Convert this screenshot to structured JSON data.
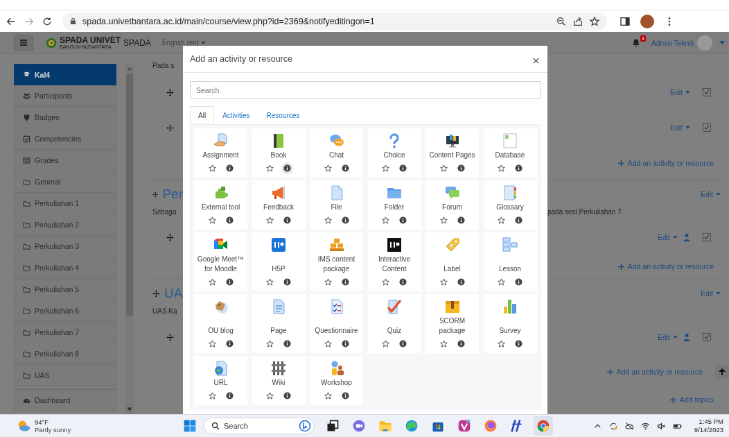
{
  "browser": {
    "url": "spada.univetbantara.ac.id/main/course/view.php?id=2369&notifyeditingon=1"
  },
  "navbar": {
    "brand": "SPADA UNIVET",
    "brand_tagline": "BANGUN NUSANTARA",
    "site_name": "SPADA",
    "language": "English (en)",
    "notification_count": "4",
    "user": "Admin Teknik"
  },
  "sidebar": {
    "items": [
      {
        "label": "Kal4",
        "kind": "course",
        "selected": true
      },
      {
        "label": "Participants",
        "kind": "participants",
        "selected": false
      },
      {
        "label": "Badges",
        "kind": "badges",
        "selected": false
      },
      {
        "label": "Competencies",
        "kind": "competencies",
        "selected": false
      },
      {
        "label": "Grades",
        "kind": "grades",
        "selected": false
      },
      {
        "label": "General",
        "kind": "section",
        "selected": false
      },
      {
        "label": "Perkuliahan 1",
        "kind": "section",
        "selected": false
      },
      {
        "label": "Perkuliahan 2",
        "kind": "section",
        "selected": false
      },
      {
        "label": "Perkuliahan 3",
        "kind": "section",
        "selected": false
      },
      {
        "label": "Perkuliahan 4",
        "kind": "section",
        "selected": false
      },
      {
        "label": "Perkuliahan 5",
        "kind": "section",
        "selected": false
      },
      {
        "label": "Perkuliahan 6",
        "kind": "section",
        "selected": false
      },
      {
        "label": "Perkuliahan 7",
        "kind": "section",
        "selected": false
      },
      {
        "label": "Perkuliahan 8",
        "kind": "section",
        "selected": false
      },
      {
        "label": "UAS",
        "kind": "section",
        "selected": false
      }
    ],
    "footer_items": [
      {
        "label": "Dashboard",
        "kind": "dashboard",
        "selected": false
      }
    ]
  },
  "course": {
    "sections": [
      {
        "summary_left": "Pada s",
        "activities": [
          {
            "edit": "Edit",
            "group_mode": false,
            "completed": false
          },
          {
            "edit": "Edit",
            "group_mode": false,
            "completed": false
          }
        ],
        "add": "Add an activity or resource"
      },
      {
        "title": "Per",
        "edit": "Edit",
        "summary_left": "Sebaga",
        "summary_right": "pada sesi Perkuliahan 7.",
        "activities": [
          {
            "edit": "Edit",
            "group_mode": true,
            "completed": false
          }
        ],
        "add": "Add an activity or resource"
      },
      {
        "title": "UA",
        "edit": "Edit",
        "summary_left": "UAS Ka",
        "activities": [
          {
            "edit": "Edit",
            "group_mode": true,
            "completed": false
          }
        ],
        "add": "Add an activity or resource"
      }
    ],
    "add_topics": "Add topics"
  },
  "modal": {
    "title": "Add an activity or resource",
    "search": {
      "placeholder": "Search"
    },
    "tabs": [
      {
        "label": "All",
        "selected": true
      },
      {
        "label": "Activities",
        "selected": false
      },
      {
        "label": "Resources",
        "selected": false
      }
    ],
    "modules": [
      {
        "name": "Assignment",
        "kind": "assignment",
        "starred": false,
        "info_hovered": false
      },
      {
        "name": "Book",
        "kind": "book",
        "starred": false,
        "info_hovered": true
      },
      {
        "name": "Chat",
        "kind": "chat",
        "starred": false,
        "info_hovered": false
      },
      {
        "name": "Choice",
        "kind": "choice",
        "starred": false,
        "info_hovered": false
      },
      {
        "name": "Content Pages",
        "kind": "content",
        "starred": false,
        "info_hovered": false
      },
      {
        "name": "Database",
        "kind": "database",
        "starred": false,
        "info_hovered": false
      },
      {
        "name": "External tool",
        "kind": "external",
        "starred": false,
        "info_hovered": false
      },
      {
        "name": "Feedback",
        "kind": "feedback",
        "starred": false,
        "info_hovered": false
      },
      {
        "name": "File",
        "kind": "file",
        "starred": false,
        "info_hovered": false
      },
      {
        "name": "Folder",
        "kind": "folder",
        "starred": false,
        "info_hovered": false
      },
      {
        "name": "Forum",
        "kind": "forum",
        "starred": false,
        "info_hovered": false
      },
      {
        "name": "Glossary",
        "kind": "glossary",
        "starred": false,
        "info_hovered": false
      },
      {
        "name": "Google Meet™ for Moodle",
        "kind": "meet",
        "starred": false,
        "info_hovered": false
      },
      {
        "name": "H5P",
        "kind": "h5p",
        "starred": false,
        "info_hovered": false
      },
      {
        "name": "IMS content package",
        "kind": "ims",
        "starred": false,
        "info_hovered": false
      },
      {
        "name": "Interactive Content",
        "kind": "interactive",
        "starred": false,
        "info_hovered": false
      },
      {
        "name": "Label",
        "kind": "label",
        "starred": false,
        "info_hovered": false
      },
      {
        "name": "Lesson",
        "kind": "lesson",
        "starred": false,
        "info_hovered": false
      },
      {
        "name": "OU blog",
        "kind": "oublog",
        "starred": false,
        "info_hovered": false
      },
      {
        "name": "Page",
        "kind": "page",
        "starred": false,
        "info_hovered": false
      },
      {
        "name": "Questionnaire",
        "kind": "questionnaire",
        "starred": false,
        "info_hovered": false
      },
      {
        "name": "Quiz",
        "kind": "quiz",
        "starred": false,
        "info_hovered": false
      },
      {
        "name": "SCORM package",
        "kind": "scorm",
        "starred": false,
        "info_hovered": false
      },
      {
        "name": "Survey",
        "kind": "survey",
        "starred": false,
        "info_hovered": false
      },
      {
        "name": "URL",
        "kind": "url",
        "starred": false,
        "info_hovered": false
      },
      {
        "name": "Wiki",
        "kind": "wiki",
        "starred": false,
        "info_hovered": false
      },
      {
        "name": "Workshop",
        "kind": "workshop",
        "starred": false,
        "info_hovered": false
      }
    ]
  },
  "taskbar": {
    "weather": {
      "temperature": "94°F",
      "condition": "Partly sunny"
    },
    "search": {
      "placeholder": "Search"
    },
    "apps": [
      {
        "kind": "taskview",
        "selected": false
      },
      {
        "kind": "chat",
        "selected": false
      },
      {
        "kind": "explorer",
        "selected": false
      },
      {
        "kind": "edge",
        "selected": false
      },
      {
        "kind": "store",
        "selected": false
      },
      {
        "kind": "vivaldi",
        "selected": false
      },
      {
        "kind": "firefox",
        "selected": false
      },
      {
        "kind": "slash",
        "selected": false
      },
      {
        "kind": "chrome",
        "selected": true
      }
    ],
    "time": "1:45 PM",
    "date": "9/14/2023"
  }
}
